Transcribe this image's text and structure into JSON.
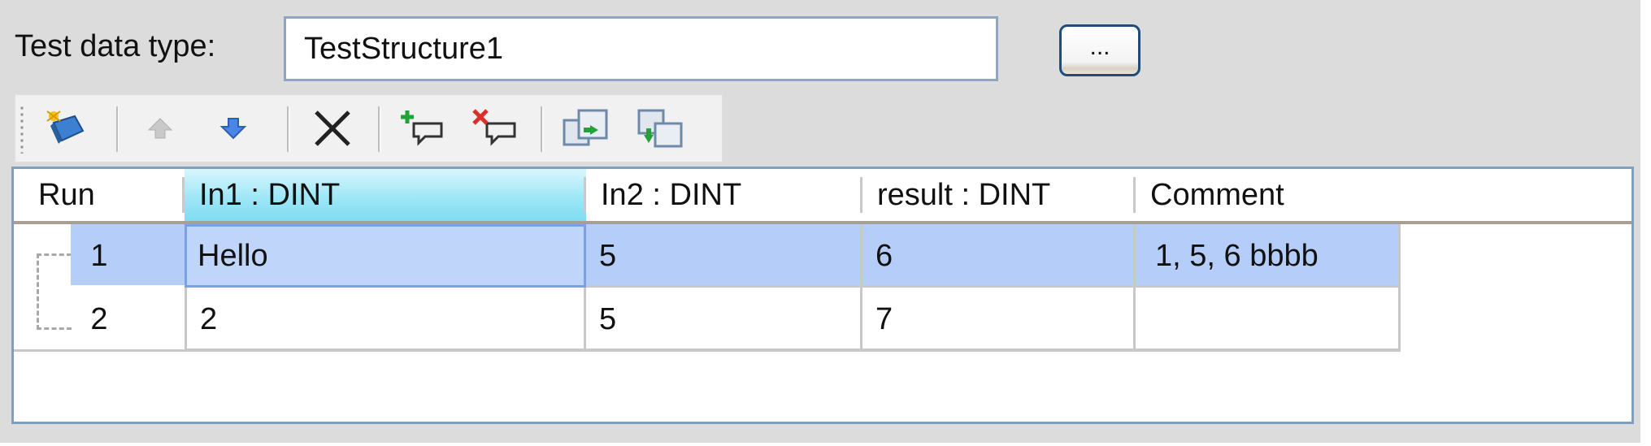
{
  "form": {
    "test_data_type_label": "Test data type:",
    "test_data_type_value": "TestStructure1",
    "browse_label": "..."
  },
  "toolbar": {
    "items": [
      {
        "name": "edit-structure-icon"
      },
      {
        "name": "move-up-icon"
      },
      {
        "name": "move-down-icon"
      },
      {
        "name": "delete-icon"
      },
      {
        "name": "add-row-icon"
      },
      {
        "name": "remove-row-icon"
      },
      {
        "name": "copy-icon"
      },
      {
        "name": "paste-icon"
      }
    ]
  },
  "grid": {
    "columns": [
      "Run",
      "In1 : DINT",
      "In2 : DINT",
      "result : DINT",
      "Comment"
    ],
    "active_column": 1,
    "rows": [
      {
        "run": "1",
        "in1": "Hello",
        "in2": "5",
        "result": "6",
        "comment": "1, 5, 6 bbbb",
        "selected": true
      },
      {
        "run": "2",
        "in1": "2",
        "in2": "5",
        "result": "7",
        "comment": "",
        "selected": false
      }
    ]
  },
  "colors": {
    "selection": "#b4cdf9",
    "header_active": "#9ee7f7",
    "border_blue": "#7f9fc0",
    "button_border": "#1f4c7a"
  }
}
